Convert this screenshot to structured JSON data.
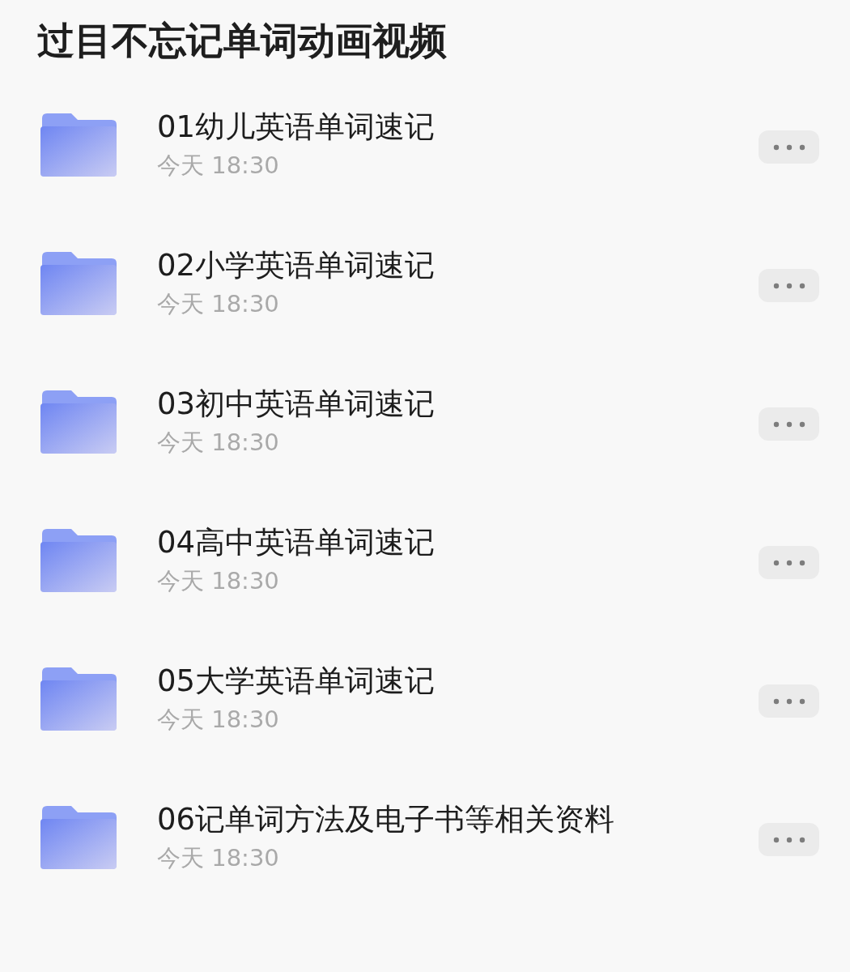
{
  "title": "过目不忘记单词动画视频",
  "folders": [
    {
      "name": "01幼儿英语单词速记",
      "date": "今天 18:30"
    },
    {
      "name": "02小学英语单词速记",
      "date": "今天 18:30"
    },
    {
      "name": "03初中英语单词速记",
      "date": "今天 18:30"
    },
    {
      "name": "04高中英语单词速记",
      "date": "今天 18:30"
    },
    {
      "name": "05大学英语单词速记",
      "date": "今天 18:30"
    },
    {
      "name": "06记单词方法及电子书等相关资料",
      "date": "今天 18:30"
    }
  ]
}
